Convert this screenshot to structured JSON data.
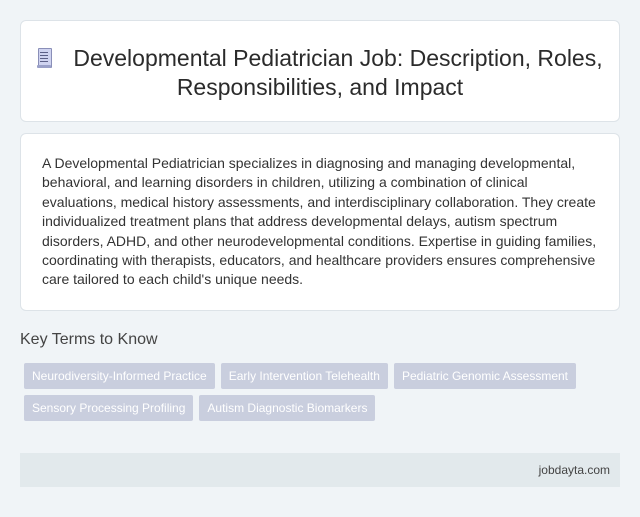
{
  "header": {
    "icon": "document-icon",
    "title": "Developmental Pediatrician Job: Description, Roles, Responsibilities, and Impact"
  },
  "description": {
    "text": "A Developmental Pediatrician specializes in diagnosing and managing developmental, behavioral, and learning disorders in children, utilizing a combination of clinical evaluations, medical history assessments, and interdisciplinary collaboration. They create individualized treatment plans that address developmental delays, autism spectrum disorders, ADHD, and other neurodevelopmental conditions. Expertise in guiding families, coordinating with therapists, educators, and healthcare providers ensures comprehensive care tailored to each child's unique needs."
  },
  "key_terms": {
    "heading": "Key Terms to Know",
    "tags": [
      "Neurodiversity-Informed Practice",
      "Early Intervention Telehealth",
      "Pediatric Genomic Assessment",
      "Sensory Processing Profiling",
      "Autism Diagnostic Biomarkers"
    ]
  },
  "footer": {
    "site": "jobdayta.com"
  },
  "colors": {
    "background": "#f0f4f7",
    "tag_background": "#c9cede",
    "footer_background": "#e2e9ec"
  }
}
